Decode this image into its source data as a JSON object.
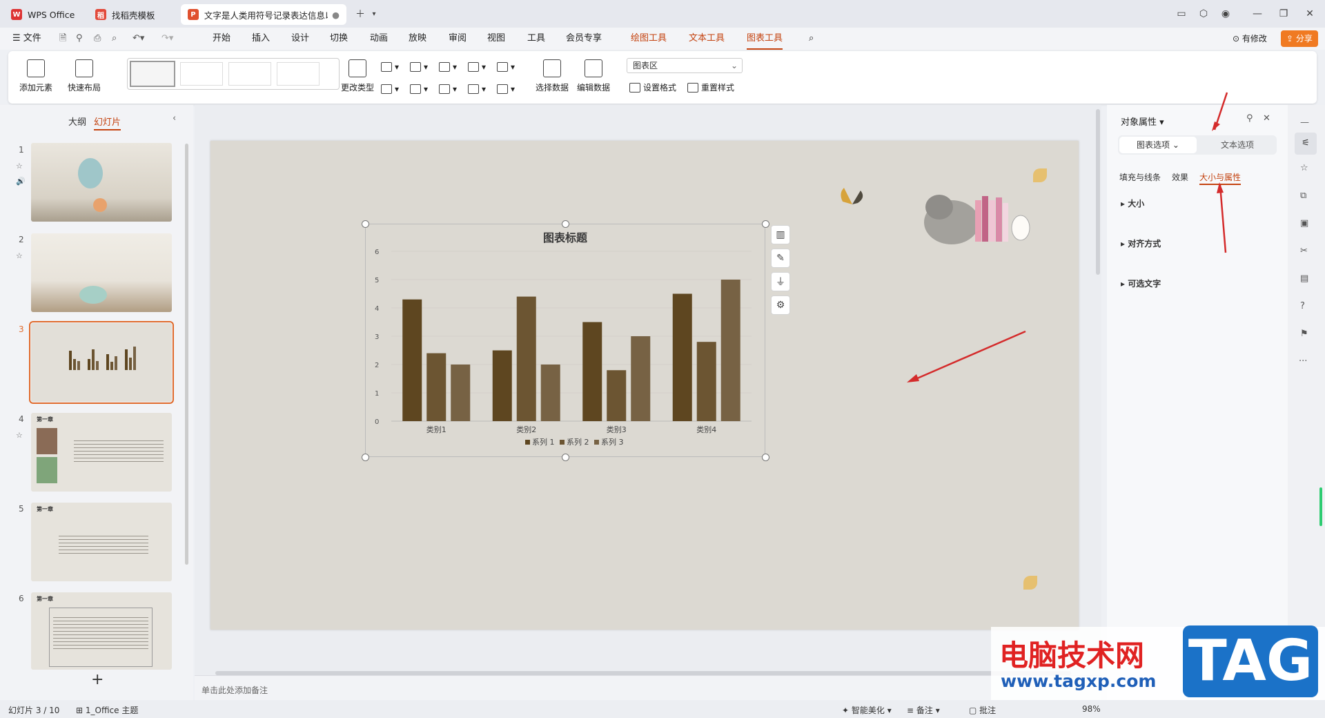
{
  "tabs": [
    {
      "label": "WPS Office"
    },
    {
      "label": "找稻壳模板"
    },
    {
      "label": "文字是人类用符号记录表达信息以"
    }
  ],
  "menu": {
    "file": "文件",
    "items": [
      "开始",
      "插入",
      "设计",
      "切换",
      "动画",
      "放映",
      "审阅",
      "视图",
      "工具",
      "会员专享"
    ],
    "context": [
      "绘图工具",
      "文本工具",
      "图表工具"
    ],
    "has_changes": "有修改",
    "share": "分享"
  },
  "ribbon": {
    "add_element": "添加元素",
    "quick_layout": "快速布局",
    "change_type": "更改类型",
    "select_data": "选择数据",
    "edit_data": "编辑数据",
    "area_select": "图表区",
    "set_format": "设置格式",
    "reset_style": "重置样式"
  },
  "left": {
    "tab_outline": "大纲",
    "tab_slides": "幻灯片",
    "slide_nums": [
      "1",
      "2",
      "3",
      "4",
      "5",
      "6"
    ],
    "chapter": "第一章",
    "add": "+"
  },
  "notes_placeholder": "单击此处添加备注",
  "chart_data": {
    "type": "bar",
    "title": "图表标题",
    "categories": [
      "类别1",
      "类别2",
      "类别3",
      "类别4"
    ],
    "series": [
      {
        "name": "系列 1",
        "values": [
          4.3,
          2.5,
          3.5,
          4.5
        ],
        "color": "#5e4620"
      },
      {
        "name": "系列 2",
        "values": [
          2.4,
          4.4,
          1.8,
          2.8
        ],
        "color": "#6c5532"
      },
      {
        "name": "系列 3",
        "values": [
          2.0,
          2.0,
          3.0,
          5.0
        ],
        "color": "#776244"
      }
    ],
    "yticks": [
      "0",
      "1",
      "2",
      "3",
      "4",
      "5",
      "6"
    ],
    "ylim": [
      0,
      6
    ],
    "legend": "bottom",
    "grid": true
  },
  "right": {
    "title": "对象属性",
    "tab_chart": "图表选项",
    "tab_text": "文本选项",
    "sub_fill": "填充与线条",
    "sub_effect": "效果",
    "sub_size": "大小与属性",
    "sections": [
      "大小",
      "对齐方式",
      "可选文字"
    ]
  },
  "status": {
    "slide_info": "幻灯片 3 / 10",
    "theme": "1_Office 主题",
    "beautify": "智能美化",
    "notes": "备注",
    "comments": "批注",
    "zoom": "98%"
  },
  "watermark": {
    "line1": "电脑技术网",
    "url": "www.tagxp.com",
    "tag": "TAG"
  }
}
